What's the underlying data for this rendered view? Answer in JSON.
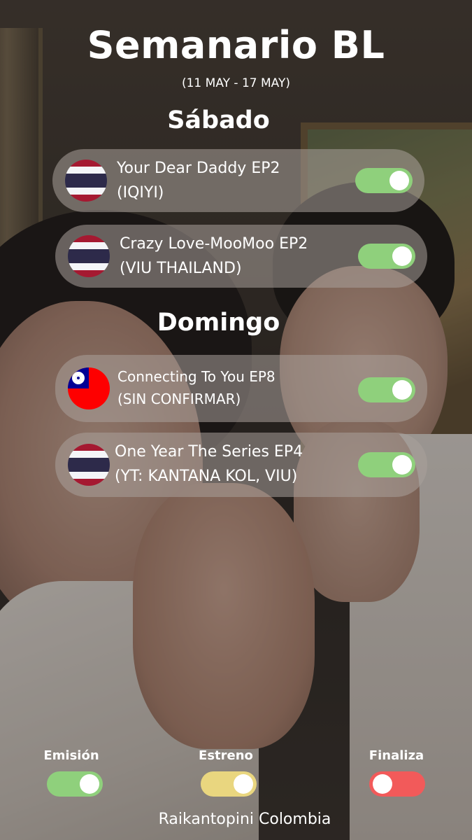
{
  "header": {
    "title": "Semanario BL",
    "date_range": "(11 MAY - 17 MAY)"
  },
  "colors": {
    "emision": "#8fd07c",
    "estreno": "#e9d67f",
    "finaliza": "#f25a5a",
    "card_bg": "rgba(170,160,155,0.55)"
  },
  "schedule": [
    {
      "day": "Sábado",
      "shows": [
        {
          "line1": "Your Dear Daddy EP2",
          "line2": "(IQIYI)",
          "flag": "thailand-flag",
          "status": "emision"
        },
        {
          "line1": "Crazy Love-MooMoo EP2",
          "line2": "(VIU THAILAND)",
          "flag": "thailand-flag",
          "status": "emision"
        }
      ]
    },
    {
      "day": "Domingo",
      "shows": [
        {
          "line1": "Connecting To You EP8",
          "line2": "(SIN CONFIRMAR)",
          "flag": "taiwan-flag",
          "status": "emision"
        },
        {
          "line1": "One Year The Series EP4",
          "line2": "(YT: KANTANA KOL, VIU)",
          "flag": "thailand-flag",
          "status": "emision"
        }
      ]
    }
  ],
  "legend": [
    {
      "label": "Emisión",
      "state": "on"
    },
    {
      "label": "Estreno",
      "state": "on"
    },
    {
      "label": "Finaliza",
      "state": "off"
    }
  ],
  "footer": {
    "credit": "Raikantopini Colombia"
  }
}
